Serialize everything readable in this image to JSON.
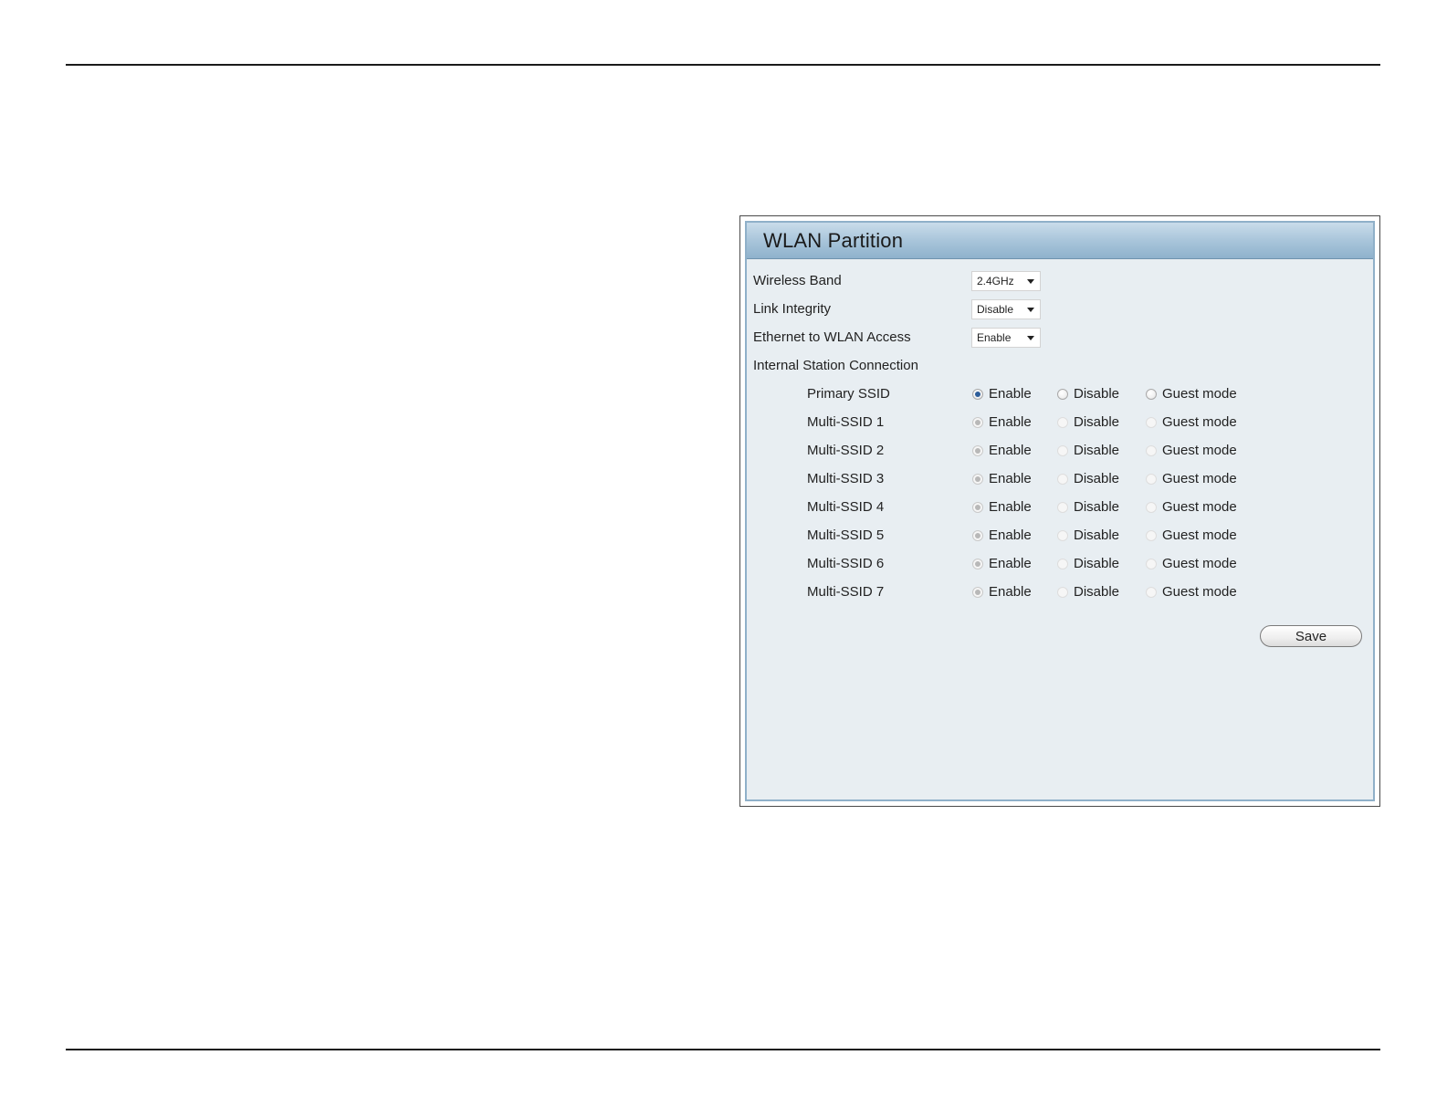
{
  "panel": {
    "title": "WLAN Partition",
    "fields": [
      {
        "label": "Wireless Band",
        "value": "2.4GHz"
      },
      {
        "label": "Link Integrity",
        "value": "Disable"
      },
      {
        "label": "Ethernet to WLAN Access",
        "value": "Enable"
      }
    ],
    "section_label": "Internal Station Connection",
    "options": {
      "enable": "Enable",
      "disable": "Disable",
      "guest": "Guest mode"
    },
    "ssids": [
      {
        "name": "Primary SSID",
        "selected": "Enable",
        "enabled": true
      },
      {
        "name": "Multi-SSID 1",
        "selected": "Enable",
        "enabled": false
      },
      {
        "name": "Multi-SSID 2",
        "selected": "Enable",
        "enabled": false
      },
      {
        "name": "Multi-SSID 3",
        "selected": "Enable",
        "enabled": false
      },
      {
        "name": "Multi-SSID 4",
        "selected": "Enable",
        "enabled": false
      },
      {
        "name": "Multi-SSID 5",
        "selected": "Enable",
        "enabled": false
      },
      {
        "name": "Multi-SSID 6",
        "selected": "Enable",
        "enabled": false
      },
      {
        "name": "Multi-SSID 7",
        "selected": "Enable",
        "enabled": false
      }
    ],
    "save_label": "Save"
  },
  "colors": {
    "header_gradient": "#a6c3d9",
    "panel_bg": "#e8eef2",
    "radio_checked": "#2d5d9a"
  }
}
